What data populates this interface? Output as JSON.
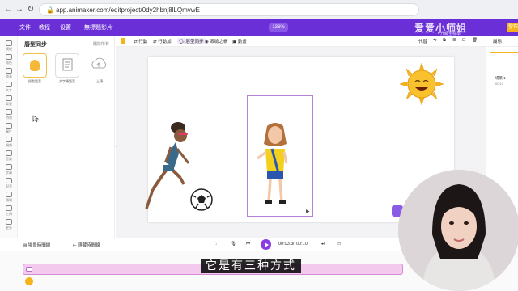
{
  "browser": {
    "url": "app.animaker.com/editproject/0dy2hbnj8lLQmvwE"
  },
  "appbar": {
    "menu": [
      "文件",
      "教程",
      "设置",
      "無標題影片"
    ],
    "zoom": "136%",
    "brand_text": "爱爱小师姐",
    "brand_sub": "• 升級至標準",
    "publish_label": "發布"
  },
  "rail": {
    "items": [
      "模板",
      "角色",
      "道具",
      "文本",
      "背景",
      "特效",
      "圖片",
      "視頻",
      "音樂",
      "字幕",
      "配音",
      "轉場",
      "上傳",
      "更多"
    ]
  },
  "panel": {
    "title": "唇型同步",
    "link": "刪除所有",
    "options": [
      "錄製語音",
      "文字轉語音",
      "上傳"
    ]
  },
  "toolbar": {
    "items": [
      "行動",
      "行動加",
      "唇型同步",
      "眼瞼之帳",
      "動畫"
    ],
    "right": [
      "代替",
      "屬態"
    ]
  },
  "scenes": {
    "label": "場景 1",
    "time": "00:10"
  },
  "playbar": {
    "left_label": "場景時間線",
    "left2_label": "隱藏時間線",
    "current_time": "00:03.3",
    "separator": "/",
    "total_time": "00:10"
  },
  "subtitle": "它是有三种方式",
  "colors": {
    "accent": "#6a2fd6",
    "play": "#8a3be6",
    "track": "#f3c9ee",
    "sun": "#f6b21b"
  }
}
